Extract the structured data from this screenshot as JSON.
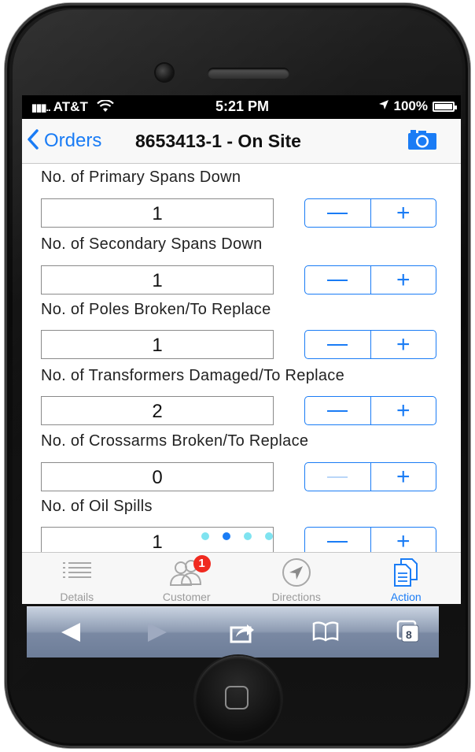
{
  "status_bar": {
    "carrier": "AT&T",
    "time": "5:21 PM",
    "battery": "100%"
  },
  "nav": {
    "back_label": "Orders",
    "title": "8653413-1 - On Site"
  },
  "fields": [
    {
      "label": "No. of Primary Spans Down",
      "value": "1"
    },
    {
      "label": "No. of Secondary Spans Down",
      "value": "1"
    },
    {
      "label": "No. of Poles Broken/To Replace",
      "value": "1"
    },
    {
      "label": "No. of Transformers Damaged/To Replace",
      "value": "2"
    },
    {
      "label": "No. of Crossarms Broken/To Replace",
      "value": "0"
    },
    {
      "label": "No. of Oil Spills",
      "value": "1"
    }
  ],
  "stepper": {
    "minus": "—",
    "plus": "+"
  },
  "pager": {
    "count": 4,
    "active_index": 1
  },
  "tabs": [
    {
      "label": "Details",
      "icon": "list-icon"
    },
    {
      "label": "Customer",
      "icon": "people-icon",
      "badge": "1"
    },
    {
      "label": "Directions",
      "icon": "location-arrow-icon"
    },
    {
      "label": "Action",
      "icon": "documents-icon",
      "active": true
    }
  ],
  "safari_toolbar": {
    "tab_count": "8"
  },
  "colors": {
    "accent": "#1a7cf5",
    "badge": "#f02a20",
    "pager_dot": "#7fe3f0"
  }
}
